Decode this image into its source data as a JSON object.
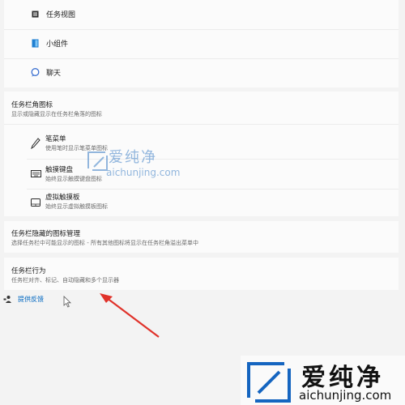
{
  "taskbar_items": {
    "task_view": "任务视图",
    "widgets": "小组件",
    "chat": "聊天"
  },
  "corner_icons": {
    "title": "任务栏角图标",
    "subtitle": "显示或隐藏显示在任务栏角落的图标",
    "items": [
      {
        "label": "笔菜单",
        "desc": "使用笔时显示笔菜单图标"
      },
      {
        "label": "触摸键盘",
        "desc": "始终显示触摸键盘图标"
      },
      {
        "label": "虚拟触摸板",
        "desc": "始终显示虚拟触摸板图标"
      }
    ]
  },
  "overflow": {
    "title": "任务栏隐藏的图标管理",
    "subtitle": "选择任务栏中可能显示的图标 - 所有其他图标将显示在任务栏角溢出菜单中"
  },
  "behaviors": {
    "title": "任务栏行为",
    "subtitle": "任务栏对齐、标记、自动隐藏和多个显示器"
  },
  "feedback": {
    "label": "提供反馈"
  },
  "watermark": {
    "brand": "爱纯净",
    "url": "aichunjing.com"
  },
  "colors": {
    "accent": "#0067c0",
    "arrow": "#e0322a",
    "logo_blue": "#1565c0"
  }
}
